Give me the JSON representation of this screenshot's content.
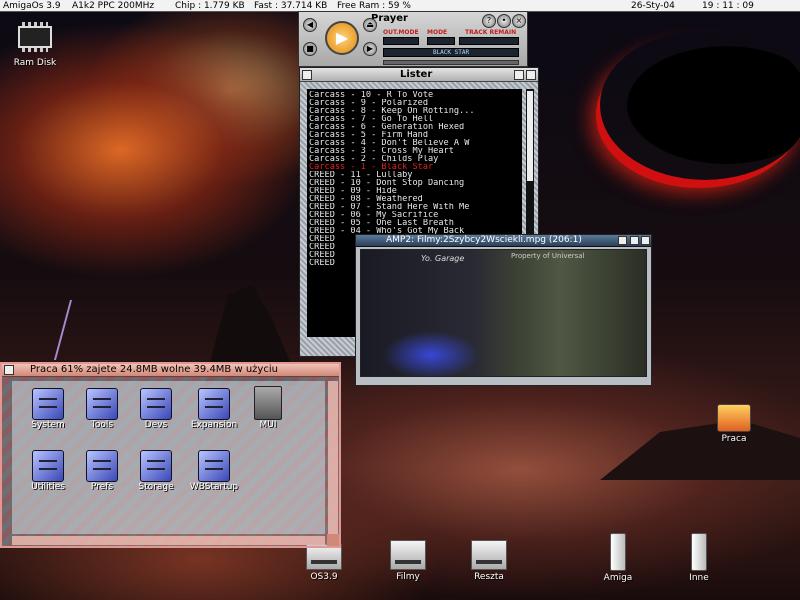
{
  "menubar": {
    "os": "AmigaOs 3.9",
    "cpu": "A1k2 PPC 200MHz",
    "chip": "Chip : 1.779 KB",
    "fast": "Fast : 37.714 KB",
    "freeram": "Free Ram : 59 %",
    "date": "26-Sty-04",
    "time": "19 : 11 : 09"
  },
  "desktop": {
    "ramdisk": "Ram Disk",
    "praca": "Praca",
    "os39": "OS3.9",
    "filmy": "Filmy",
    "reszta": "Reszta",
    "amiga": "Amiga",
    "inne": "Inne"
  },
  "prayer": {
    "title": "Prayer",
    "outmode_label": "OUT.MODE",
    "mode_label": "MODE",
    "track_remain_label": "TRACK REMAIN",
    "track_name": "BLACK STAR"
  },
  "lister": {
    "title": "Lister",
    "tracks": [
      "Carcass - 10 - R To Vote",
      "Carcass - 9 - Polarized",
      "Carcass - 8 - Keep On Rotting...",
      "Carcass - 7 - Go To Hell",
      "Carcass - 6 - Generation Hexed",
      "Carcass - 5 - Firm Hand",
      "Carcass - 4 - Don't Believe A W",
      "Carcass - 3 - Cross My Heart",
      "Carcass - 2 - Childs Play",
      "Carcass - 1 - Black Star",
      "CREED - 11 - Lullaby",
      "CREED - 10 - Dont Stop Dancing",
      "CREED - 09 - Hide",
      "CREED - 08 - Weathered",
      "CREED - 07 - Stand Here With Me",
      "CREED - 06 - My Sacrifice",
      "CREED - 05 - One Last Breath",
      "CREED - 04 - Who's Got My Back",
      "CREED",
      "CREED",
      "CREED",
      "CREED"
    ],
    "active_index": 9
  },
  "amp": {
    "title": "AMP2: Filmy:2Szybcy2Wsciekli.mpg (206:1)",
    "sign": "Yo. Garage",
    "copyright": "Property of Universal"
  },
  "praca_window": {
    "title": "Praca  61% zajete  24.8MB wolne  39.4MB w użyciu",
    "icons": [
      "System",
      "Tools",
      "Devs",
      "Expansion",
      "MUI",
      "Utilities",
      "Prefs",
      "Storage",
      "WBStartup"
    ]
  }
}
